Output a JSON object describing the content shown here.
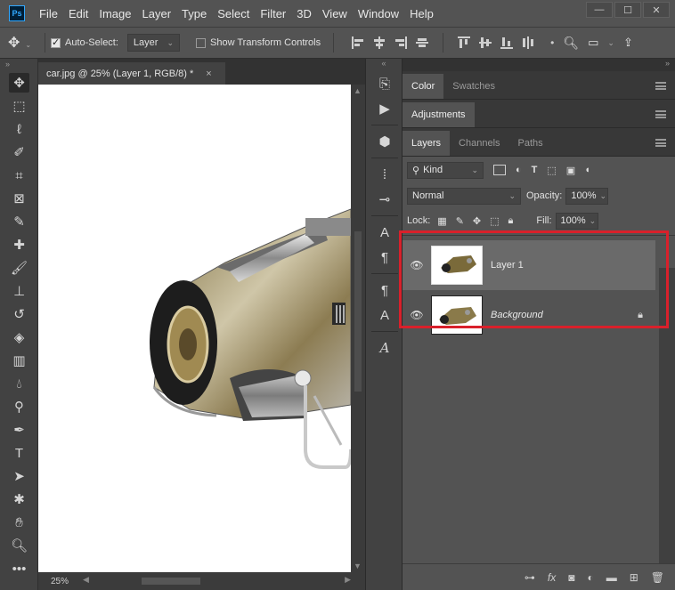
{
  "app": {
    "logo": "Ps"
  },
  "menu": [
    "File",
    "Edit",
    "Image",
    "Layer",
    "Type",
    "Select",
    "Filter",
    "3D",
    "View",
    "Window",
    "Help"
  ],
  "window_controls": {
    "minimize": "—",
    "restore": "☐",
    "close": "✕"
  },
  "options": {
    "auto_select_label": "Auto-Select:",
    "auto_select_checked": true,
    "auto_select_target": "Layer",
    "show_transform_label": "Show Transform Controls",
    "show_transform_checked": false
  },
  "document": {
    "tab_title": "car.jpg @ 25% (Layer 1, RGB/8) *",
    "close": "×",
    "zoom": "25%"
  },
  "panels": {
    "top_tabs": [
      "Color",
      "Swatches"
    ],
    "adjustments_tab": "Adjustments",
    "layer_tabs": [
      "Layers",
      "Channels",
      "Paths"
    ],
    "kind_label": "Kind",
    "blend_mode": "Normal",
    "opacity_label": "Opacity:",
    "opacity_value": "100%",
    "lock_label": "Lock:",
    "fill_label": "Fill:",
    "fill_value": "100%"
  },
  "layers": [
    {
      "name": "Layer 1",
      "selected": true,
      "locked": false
    },
    {
      "name": "Background",
      "selected": false,
      "locked": true
    }
  ],
  "colors": {
    "highlight": "#d9202b",
    "canvas": "#ffffff",
    "ui_dark": "#323232",
    "ui_mid": "#535353"
  }
}
